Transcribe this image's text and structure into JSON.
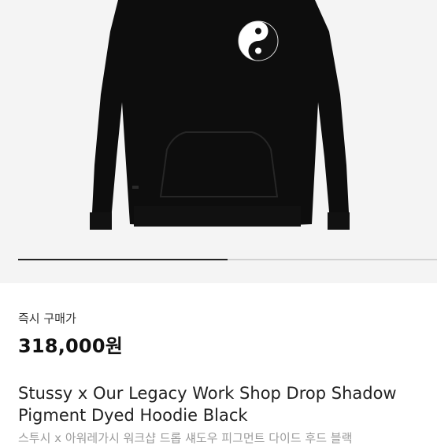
{
  "product": {
    "image_alt": "black hoodie with yin-yang logo",
    "carousel_progress": 0.5,
    "colors": {
      "hoodie": "#0d0d0d",
      "background": "#f4f4f4",
      "accent": "#222222"
    }
  },
  "pricing": {
    "label": "즉시 구매가",
    "price": "318,000원"
  },
  "title": {
    "en": "Stussy x Our Legacy Work Shop Drop Shadow Pigment Dyed Hoodie Black",
    "ko": "스투시 x 아워레가시 워크샵 드롭 섀도우 피그먼트 다이드 후드 블랙"
  }
}
